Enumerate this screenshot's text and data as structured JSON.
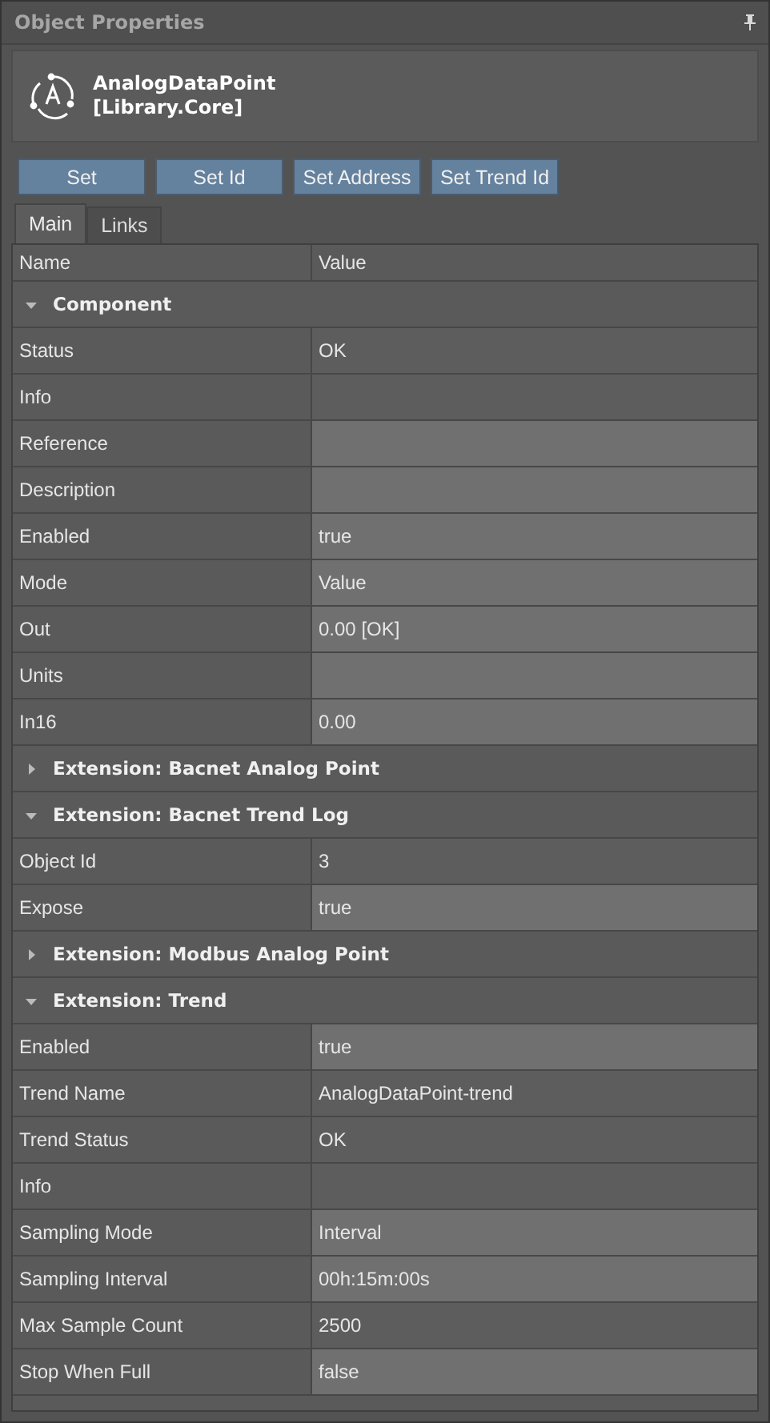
{
  "panel": {
    "title": "Object Properties"
  },
  "object": {
    "name": "AnalogDataPoint",
    "library": "[Library.Core]"
  },
  "buttons": [
    "Set",
    "Set Id",
    "Set Address",
    "Set Trend Id"
  ],
  "tabs": [
    {
      "label": "Main",
      "selected": true
    },
    {
      "label": "Links",
      "selected": false
    }
  ],
  "table": {
    "columns": [
      "Name",
      "Value"
    ],
    "rows": [
      {
        "kind": "section",
        "label": "Component",
        "expanded": true
      },
      {
        "kind": "property",
        "name": "Status",
        "value": "OK",
        "editable": false
      },
      {
        "kind": "property",
        "name": "Info",
        "editable": false
      },
      {
        "kind": "property",
        "name": "Reference",
        "editable": true
      },
      {
        "kind": "property",
        "name": "Description",
        "editable": true
      },
      {
        "kind": "property",
        "name": "Enabled",
        "value": "true",
        "editable": true
      },
      {
        "kind": "property",
        "name": "Mode",
        "value": "Value",
        "editable": true
      },
      {
        "kind": "property",
        "name": "Out",
        "value": "0.00  [OK]",
        "editable": true
      },
      {
        "kind": "property",
        "name": "Units",
        "editable": true
      },
      {
        "kind": "property",
        "name": "In16",
        "value": "0.00",
        "editable": true
      },
      {
        "kind": "section",
        "label": "Extension: Bacnet Analog Point",
        "expanded": false
      },
      {
        "kind": "section",
        "label": "Extension: Bacnet Trend Log",
        "expanded": true
      },
      {
        "kind": "property",
        "name": "Object Id",
        "value": "3",
        "editable": false
      },
      {
        "kind": "property",
        "name": "Expose",
        "value": "true",
        "editable": true
      },
      {
        "kind": "section",
        "label": "Extension: Modbus Analog Point",
        "expanded": false
      },
      {
        "kind": "section",
        "label": "Extension: Trend",
        "expanded": true
      },
      {
        "kind": "property",
        "name": "Enabled",
        "value": "true",
        "editable": true
      },
      {
        "kind": "property",
        "name": "Trend Name",
        "value": "AnalogDataPoint-trend",
        "editable": false
      },
      {
        "kind": "property",
        "name": "Trend Status",
        "value": "OK",
        "editable": false
      },
      {
        "kind": "property",
        "name": "Info",
        "editable": false
      },
      {
        "kind": "property",
        "name": "Sampling Mode",
        "value": "Interval",
        "editable": true
      },
      {
        "kind": "property",
        "name": "Sampling Interval",
        "value": "00h:15m:00s",
        "editable": true
      },
      {
        "kind": "property",
        "name": "Max Sample Count",
        "value": "2500",
        "editable": false
      },
      {
        "kind": "property",
        "name": "Stop When Full",
        "value": "false",
        "editable": true
      }
    ]
  }
}
